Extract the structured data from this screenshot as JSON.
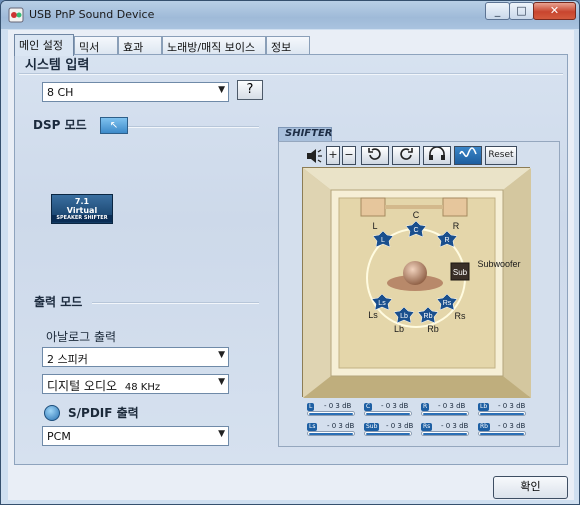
{
  "window": {
    "title": "USB PnP Sound Device",
    "min": "_",
    "max": "□",
    "close": "✕"
  },
  "tabs": [
    {
      "label": "메인 설정",
      "active": true
    },
    {
      "label": "믹서"
    },
    {
      "label": "효과"
    },
    {
      "label": "노래방/매직 보이스"
    },
    {
      "label": "정보"
    }
  ],
  "system_input": {
    "title": "시스템 입력",
    "channel": "8 CH",
    "help": "?"
  },
  "dsp": {
    "title": "DSP 모드",
    "button_glyph": "↖",
    "logo_top": "7.1",
    "logo_mid": "Virtual",
    "logo_bot": "SPEAKER SHIFTER"
  },
  "output": {
    "title": "출력 모드",
    "analog_label": "아날로그 출력",
    "analog_value": "2 스피커",
    "digital_value": "디지털 오디오",
    "digital_rate": "48 KHz",
    "spdif_label": "S/PDIF 출력",
    "spdif_value": "PCM"
  },
  "shifter": {
    "tab": "SHIFTER",
    "toolbar": {
      "reset": "Reset"
    },
    "speakers": {
      "C": "C",
      "L": "L",
      "R": "R",
      "Ls": "Ls",
      "Rs": "Rs",
      "Lb": "Lb",
      "Rb": "Rb",
      "Sub": "Sub",
      "Subwoofer": "Subwoofer",
      "badge_L": "L",
      "badge_C": "C",
      "badge_R": "R",
      "badge_Ls": "Ls",
      "badge_Rs": "Rs",
      "badge_Lb": "Lb",
      "badge_Rb": "Rb"
    },
    "levels": [
      {
        "badge": "L",
        "text": "- 0 3 dB"
      },
      {
        "badge": "C",
        "text": "- 0 3 dB"
      },
      {
        "badge": "R",
        "text": "- 0 3 dB"
      },
      {
        "badge": "Lb",
        "text": "- 0 3 dB"
      },
      {
        "badge": "Ls",
        "text": "- 0 3 dB"
      },
      {
        "badge": "Sub",
        "text": "- 0 3 dB"
      },
      {
        "badge": "Rs",
        "text": "- 0 3 dB"
      },
      {
        "badge": "Rb",
        "text": "- 0 3 dB"
      }
    ]
  },
  "footer": {
    "ok": "확인"
  }
}
